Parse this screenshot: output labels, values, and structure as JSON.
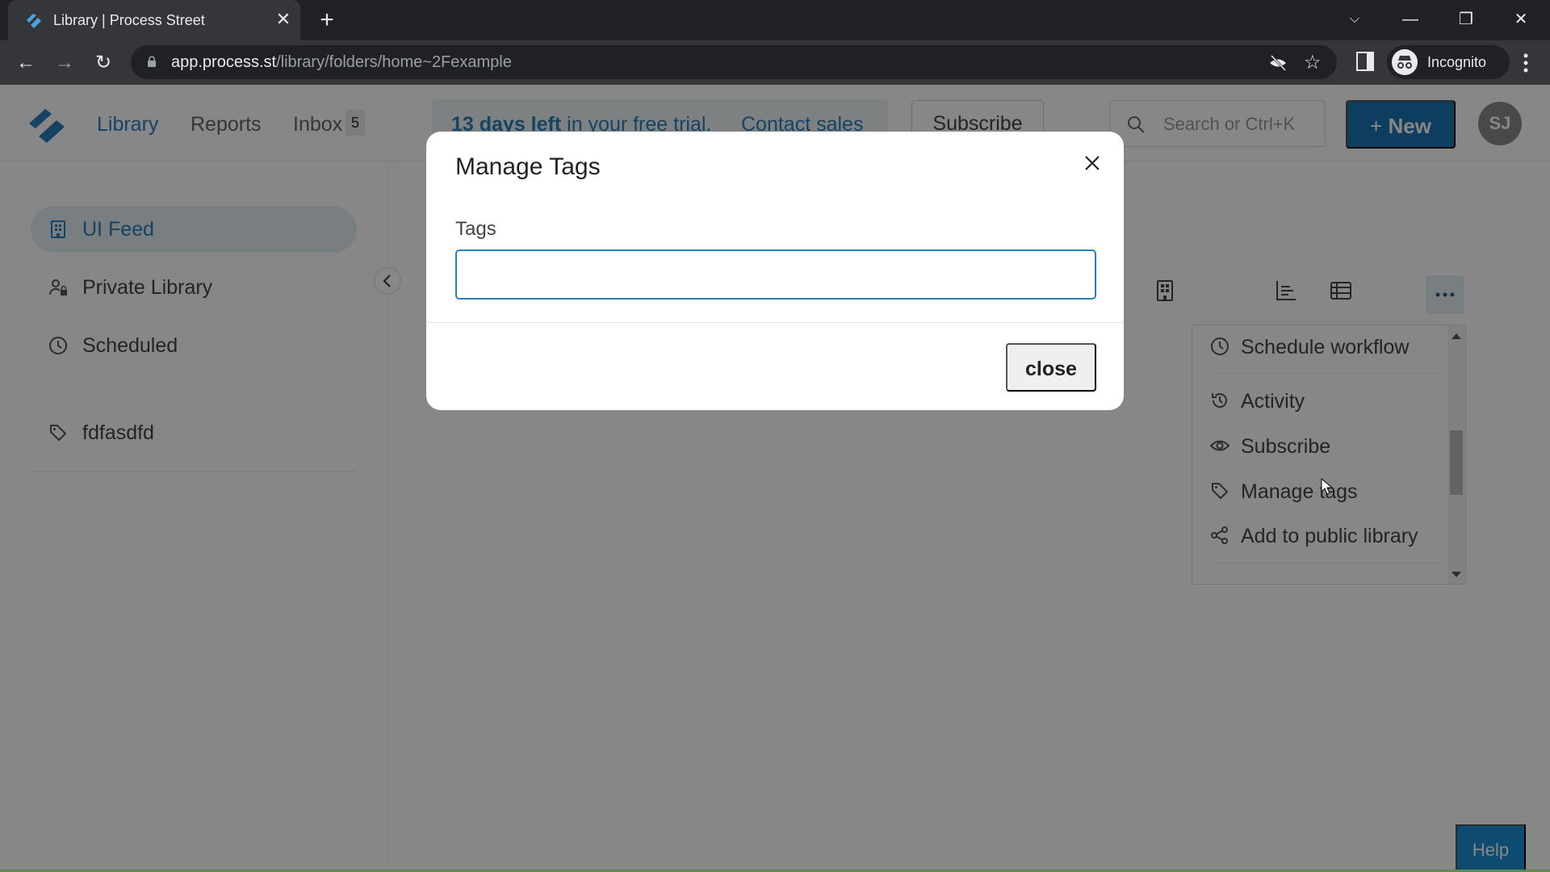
{
  "browser": {
    "tab_title": "Library | Process Street",
    "url_host": "app.process.st",
    "url_path": "/library/folders/home~2Fexample",
    "profile_label": "Incognito"
  },
  "header": {
    "nav": [
      {
        "label": "Library",
        "active": true
      },
      {
        "label": "Reports",
        "active": false
      },
      {
        "label": "Inbox",
        "active": false
      }
    ],
    "inbox_count": "5",
    "trial": {
      "bold": "13 days left",
      "rest": " in your free trial.",
      "contact_label": "Contact sales"
    },
    "subscribe_label": "Subscribe",
    "search_placeholder": "Search or Ctrl+K",
    "new_label": "New",
    "avatar_initials": "SJ"
  },
  "sidebar": {
    "items": [
      {
        "label": "UI Feed",
        "icon": "building-icon",
        "active": true
      },
      {
        "label": "Private Library",
        "icon": "user-lock-icon",
        "active": false
      },
      {
        "label": "Scheduled",
        "icon": "clock-icon",
        "active": false
      }
    ],
    "tags": [
      {
        "label": "fdfasdfd",
        "icon": "tag-icon"
      }
    ]
  },
  "menu": {
    "items": [
      {
        "label": "Schedule workflow",
        "icon": "clock-icon"
      },
      {
        "label": "Activity",
        "icon": "history-icon"
      },
      {
        "label": "Subscribe",
        "icon": "eye-icon"
      },
      {
        "label": "Manage tags",
        "icon": "tag-icon"
      },
      {
        "label": "Add to public library",
        "icon": "share-icon"
      }
    ]
  },
  "modal": {
    "title": "Manage Tags",
    "field_label": "Tags",
    "input_value": "",
    "close_label": "close"
  },
  "help_label": "Help",
  "colors": {
    "brand": "#2b7fb8",
    "primary_button": "#1a74b4",
    "help_button": "#1a8fd6"
  }
}
